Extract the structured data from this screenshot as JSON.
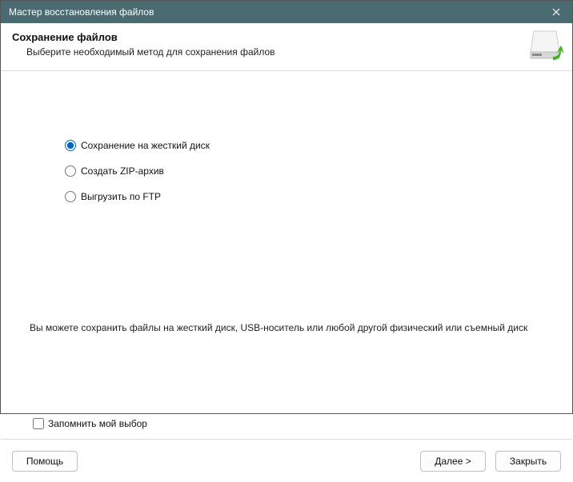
{
  "window": {
    "title": "Мастер восстановления файлов"
  },
  "header": {
    "title": "Сохранение файлов",
    "subtitle": "Выберите необходимый метод для сохранения файлов"
  },
  "options": {
    "items": [
      {
        "label": "Сохранение на жесткий диск",
        "selected": true
      },
      {
        "label": "Создать ZIP-архив",
        "selected": false
      },
      {
        "label": "Выгрузить по FTP",
        "selected": false
      }
    ]
  },
  "description": "Вы можете сохранить файлы на жесткий диск, USB-носитель или любой другой физический или съемный диск",
  "remember": {
    "label": "Запомнить мой выбор",
    "checked": false
  },
  "buttons": {
    "help": "Помощь",
    "next": "Далее >",
    "close": "Закрыть"
  }
}
